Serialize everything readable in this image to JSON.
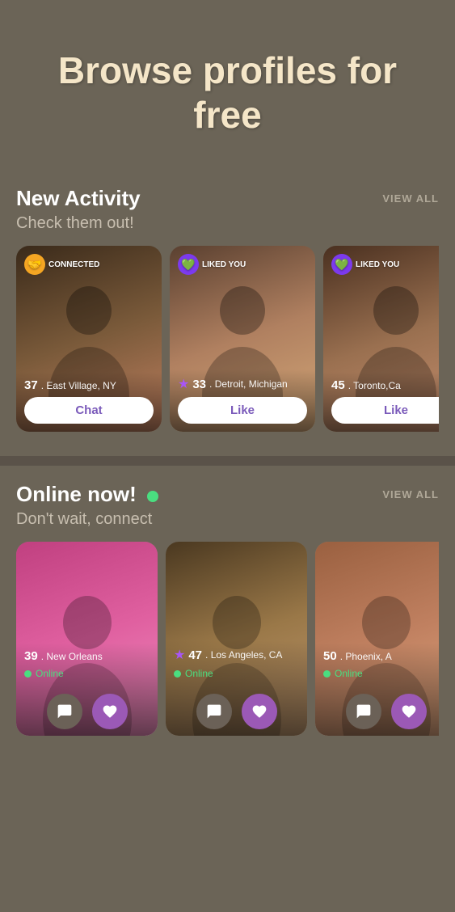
{
  "hero": {
    "title": "Browse profiles for free"
  },
  "new_activity": {
    "section_title": "New Activity",
    "subtitle": "Check them out!",
    "view_all": "VIEW ALL",
    "cards": [
      {
        "id": 1,
        "age": "37",
        "location": "East Village, NY",
        "badge_type": "connected",
        "badge_label": "CONNECTED",
        "photo_class": "p1",
        "action_label": "Chat",
        "action_type": "chat",
        "has_star": false
      },
      {
        "id": 2,
        "age": "33",
        "location": "Detroit, Michigan",
        "badge_type": "liked",
        "badge_label": "LIKED YOU",
        "photo_class": "p2",
        "action_label": "Like",
        "action_type": "like",
        "has_star": true
      },
      {
        "id": 3,
        "age": "45",
        "location": "Toronto, Ca",
        "badge_type": "liked",
        "badge_label": "LIKED YOU",
        "photo_class": "p3",
        "action_label": "Like",
        "action_type": "like",
        "has_star": false
      }
    ]
  },
  "online_now": {
    "section_title": "Online now!",
    "subtitle": "Don't wait, connect",
    "view_all": "VIEW ALL",
    "cards": [
      {
        "id": 1,
        "age": "39",
        "location": "New Orleans",
        "online_label": "Online",
        "photo_class": "p4",
        "has_star": false
      },
      {
        "id": 2,
        "age": "47",
        "location": "Los Angeles, CA",
        "online_label": "Online",
        "photo_class": "p5",
        "has_star": true
      },
      {
        "id": 3,
        "age": "50",
        "location": "Phoenix, A",
        "online_label": "Online",
        "photo_class": "p6",
        "has_star": false
      }
    ]
  },
  "icons": {
    "message": "💬",
    "heart": "♥",
    "heart_filled": "❤",
    "star": "★",
    "connected_emoji": "🤝",
    "online_indicator": "●"
  }
}
